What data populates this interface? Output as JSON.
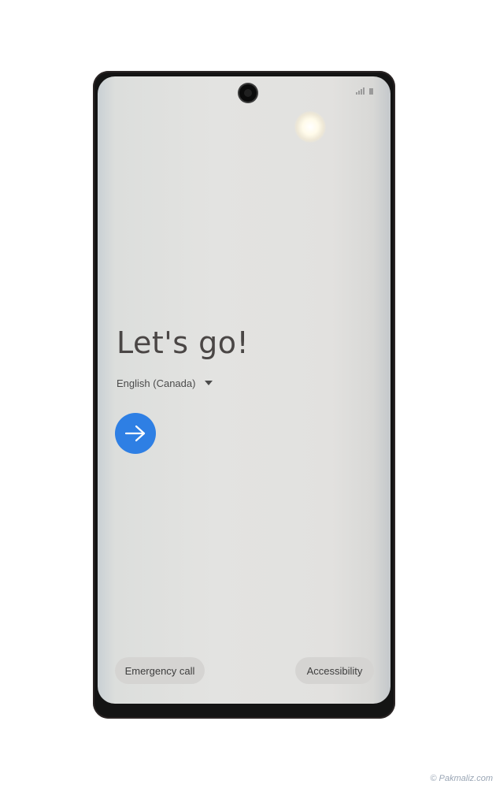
{
  "status_bar": {
    "icons": [
      "signal-icon",
      "battery-icon"
    ]
  },
  "setup": {
    "title": "Let's go!",
    "language": "English (Canada)",
    "next_icon": "arrow-right-icon"
  },
  "footer": {
    "emergency_label": "Emergency call",
    "accessibility_label": "Accessibility"
  },
  "watermark": "© Pakmaliz.com",
  "colors": {
    "accent": "#2e7fe4",
    "screen_bg": "#e2e2e0",
    "title_text": "#4a4645",
    "pill_bg": "#d5d4d2"
  }
}
